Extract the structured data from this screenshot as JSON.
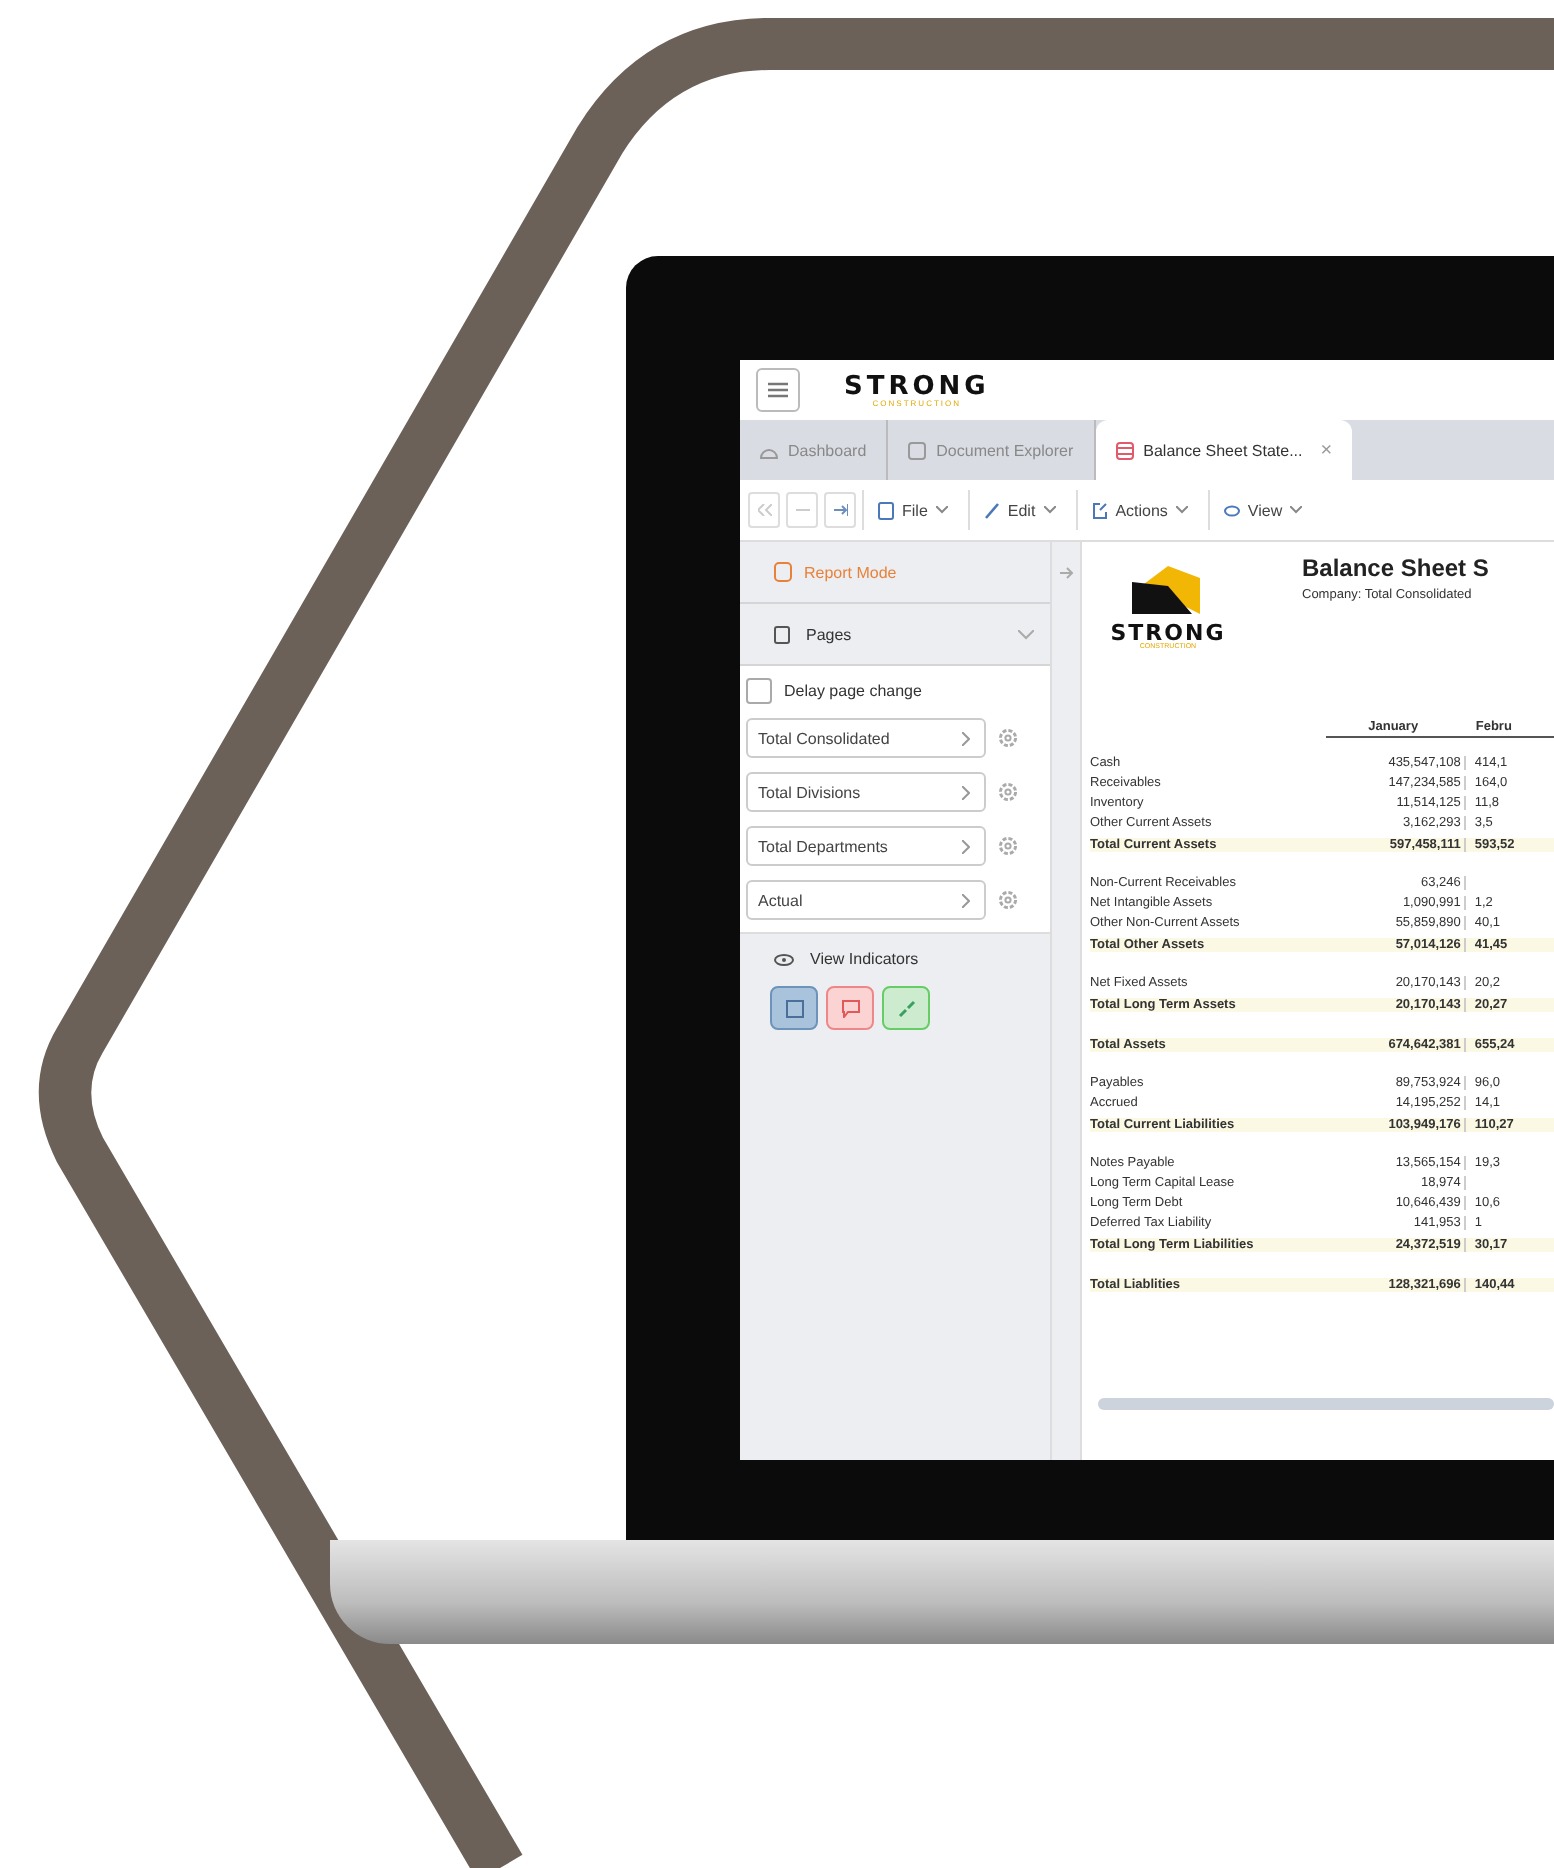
{
  "app": {
    "brand": "STRONG",
    "brand_sub": "CONSTRUCTION"
  },
  "tabs": [
    {
      "label": "Dashboard",
      "selected": false
    },
    {
      "label": "Document Explorer",
      "selected": false
    },
    {
      "label": "Balance Sheet State...",
      "selected": true,
      "close": "×"
    }
  ],
  "toolbar": [
    {
      "label": "File"
    },
    {
      "label": "Edit"
    },
    {
      "label": "Actions"
    },
    {
      "label": "View"
    }
  ],
  "sidebar": {
    "mode": "Report Mode",
    "section": "Pages",
    "delay": {
      "label": "Delay page change",
      "checked": false
    },
    "pages": [
      "Total Consolidated",
      "Total Divisions",
      "Total Departments",
      "Actual"
    ],
    "indicators": "View Indicators"
  },
  "report": {
    "title": "Balance Sheet S",
    "subtitle": "Company: Total Consolidated",
    "logo": "STRONG",
    "logo_sub": "CONSTRUCTION",
    "columns": [
      "January",
      "Febru"
    ],
    "groups": [
      [
        {
          "label": "Cash",
          "jan": "435,547,108",
          "feb": "414,1",
          "total": false
        },
        {
          "label": "Receivables",
          "jan": "147,234,585",
          "feb": "164,0",
          "total": false
        },
        {
          "label": "Inventory",
          "jan": "11,514,125",
          "feb": "11,8",
          "total": false
        },
        {
          "label": "Other Current Assets",
          "jan": "3,162,293",
          "feb": "3,5",
          "total": false
        },
        {
          "label": "Total Current Assets",
          "jan": "597,458,111",
          "feb": "593,52",
          "total": true
        }
      ],
      [
        {
          "label": "Non-Current Receivables",
          "jan": "63,246",
          "total": false
        },
        {
          "label": "Net Intangible Assets",
          "jan": "1,090,991",
          "feb": "1,2",
          "total": false
        },
        {
          "label": "Other Non-Current Assets",
          "jan": "55,859,890",
          "feb": "40,1",
          "total": false
        },
        {
          "label": "Total Other Assets",
          "jan": "57,014,126",
          "feb": "41,45",
          "total": true
        }
      ],
      [
        {
          "label": "Net Fixed Assets",
          "jan": "20,170,143",
          "feb": "20,2",
          "total": false
        },
        {
          "label": "Total Long Term Assets",
          "jan": "20,170,143",
          "feb": "20,27",
          "total": true
        }
      ],
      [
        {
          "label": "Total Assets",
          "jan": "674,642,381",
          "feb": "655,24",
          "total": true
        }
      ],
      [
        {
          "label": "Payables",
          "jan": "89,753,924",
          "feb": "96,0",
          "total": false
        },
        {
          "label": "Accrued",
          "jan": "14,195,252",
          "feb": "14,1",
          "total": false
        },
        {
          "label": "Total Current Liabilities",
          "jan": "103,949,176",
          "feb": "110,27",
          "total": true
        }
      ],
      [
        {
          "label": "Notes Payable",
          "jan": "13,565,154",
          "feb": "19,3",
          "total": false
        },
        {
          "label": "Long Term Capital Lease",
          "jan": "18,974",
          "total": false
        },
        {
          "label": "Long Term Debt",
          "jan": "10,646,439",
          "feb": "10,6",
          "total": false
        },
        {
          "label": "Deferred Tax Liability",
          "jan": "141,953",
          "feb": "1",
          "total": false
        },
        {
          "label": "Total Long Term Liabilities",
          "jan": "24,372,519",
          "feb": "30,17",
          "total": true
        }
      ],
      [
        {
          "label": "Total Liablities",
          "jan": "128,321,696",
          "feb": "140,44",
          "total": true
        }
      ]
    ]
  }
}
